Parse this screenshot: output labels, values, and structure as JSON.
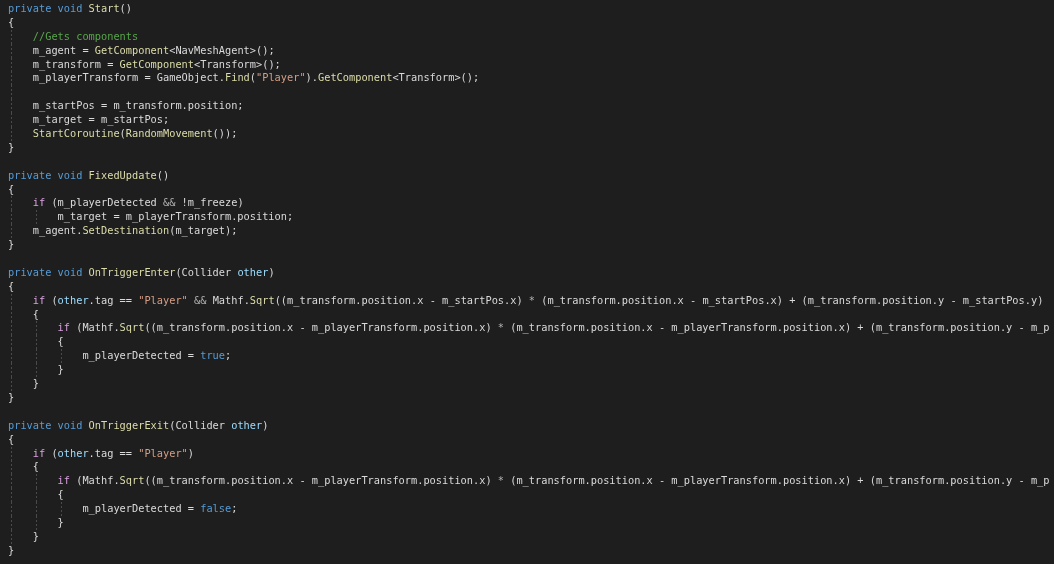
{
  "editor": {
    "lines": [
      {
        "kind": "code",
        "tokens": [
          {
            "text": "private void ",
            "kind": "keyword"
          },
          {
            "text": "Start",
            "kind": "method"
          },
          {
            "text": "()",
            "kind": "plain"
          }
        ]
      },
      {
        "kind": "code",
        "tokens": [
          {
            "text": "{",
            "kind": "plain"
          }
        ]
      },
      {
        "kind": "code",
        "tokens": [
          {
            "text": "    //Gets components",
            "kind": "comment"
          }
        ]
      },
      {
        "kind": "code",
        "tokens": [
          {
            "text": "    m_agent = ",
            "kind": "plain"
          },
          {
            "text": "GetComponent",
            "kind": "method"
          },
          {
            "text": "<NavMeshAgent>();",
            "kind": "plain"
          }
        ]
      },
      {
        "kind": "code",
        "tokens": [
          {
            "text": "    m_transform = ",
            "kind": "plain"
          },
          {
            "text": "GetComponent",
            "kind": "method"
          },
          {
            "text": "<Transform>();",
            "kind": "plain"
          }
        ]
      },
      {
        "kind": "code",
        "tokens": [
          {
            "text": "    m_playerTransform = GameObject.",
            "kind": "plain"
          },
          {
            "text": "Find",
            "kind": "method"
          },
          {
            "text": "(",
            "kind": "plain"
          },
          {
            "text": "\"Player\"",
            "kind": "string"
          },
          {
            "text": ").",
            "kind": "plain"
          },
          {
            "text": "GetComponent",
            "kind": "method"
          },
          {
            "text": "<Transform>();",
            "kind": "plain"
          }
        ]
      },
      {
        "kind": "blank"
      },
      {
        "kind": "code",
        "tokens": [
          {
            "text": "    m_startPos = m_transform.position;",
            "kind": "plain"
          }
        ]
      },
      {
        "kind": "code",
        "tokens": [
          {
            "text": "    m_target = m_startPos;",
            "kind": "plain"
          }
        ]
      },
      {
        "kind": "code",
        "tokens": [
          {
            "text": "    StartCoroutine",
            "kind": "method"
          },
          {
            "text": "(",
            "kind": "plain"
          },
          {
            "text": "RandomMovement",
            "kind": "method"
          },
          {
            "text": "());",
            "kind": "plain"
          }
        ]
      },
      {
        "kind": "code",
        "tokens": [
          {
            "text": "}",
            "kind": "plain"
          }
        ]
      },
      {
        "kind": "blank"
      },
      {
        "kind": "code",
        "tokens": [
          {
            "text": "private void ",
            "kind": "keyword"
          },
          {
            "text": "FixedUpdate",
            "kind": "method"
          },
          {
            "text": "()",
            "kind": "plain"
          }
        ]
      },
      {
        "kind": "code",
        "tokens": [
          {
            "text": "{",
            "kind": "plain"
          }
        ]
      },
      {
        "kind": "code",
        "tokens": [
          {
            "text": "    if",
            "kind": "control"
          },
          {
            "text": " (m_playerDetected ",
            "kind": "plain"
          },
          {
            "text": "&&",
            "kind": "operator"
          },
          {
            "text": " !m_freeze)",
            "kind": "plain"
          }
        ]
      },
      {
        "kind": "code",
        "tokens": [
          {
            "text": "        m_target = m_playerTransform.position;",
            "kind": "plain"
          }
        ]
      },
      {
        "kind": "code",
        "tokens": [
          {
            "text": "    m_agent.",
            "kind": "plain"
          },
          {
            "text": "SetDestination",
            "kind": "method"
          },
          {
            "text": "(m_target);",
            "kind": "plain"
          }
        ]
      },
      {
        "kind": "code",
        "tokens": [
          {
            "text": "}",
            "kind": "plain"
          }
        ]
      },
      {
        "kind": "blank"
      },
      {
        "kind": "code",
        "tokens": [
          {
            "text": "private void ",
            "kind": "keyword"
          },
          {
            "text": "OnTriggerEnter",
            "kind": "method"
          },
          {
            "text": "(Collider ",
            "kind": "plain"
          },
          {
            "text": "other",
            "kind": "param"
          },
          {
            "text": ")",
            "kind": "plain"
          }
        ]
      },
      {
        "kind": "code",
        "tokens": [
          {
            "text": "{",
            "kind": "plain"
          }
        ]
      },
      {
        "kind": "code",
        "tokens": [
          {
            "text": "    if",
            "kind": "control"
          },
          {
            "text": " (",
            "kind": "plain"
          },
          {
            "text": "other",
            "kind": "param"
          },
          {
            "text": ".tag == ",
            "kind": "plain"
          },
          {
            "text": "\"Player\"",
            "kind": "string"
          },
          {
            "text": " &&",
            "kind": "operator"
          },
          {
            "text": " Mathf.",
            "kind": "plain"
          },
          {
            "text": "Sqrt",
            "kind": "method"
          },
          {
            "text": "((m_transform.position.x - m_startPos.x) ",
            "kind": "plain"
          },
          {
            "text": "*",
            "kind": "operator"
          },
          {
            "text": " (m_transform.position.x - m_startPos.x) + (m_transform.position.y - m_startPos.y)",
            "kind": "plain"
          }
        ]
      },
      {
        "kind": "code",
        "tokens": [
          {
            "text": "    {",
            "kind": "plain"
          }
        ]
      },
      {
        "kind": "code",
        "tokens": [
          {
            "text": "        if",
            "kind": "control"
          },
          {
            "text": " (Mathf.",
            "kind": "plain"
          },
          {
            "text": "Sqrt",
            "kind": "method"
          },
          {
            "text": "((m_transform.position.x - m_playerTransform.position.x) ",
            "kind": "plain"
          },
          {
            "text": "*",
            "kind": "operator"
          },
          {
            "text": " (m_transform.position.x - m_playerTransform.position.x) + (m_transform.position.y - m_p",
            "kind": "plain"
          }
        ]
      },
      {
        "kind": "code",
        "tokens": [
          {
            "text": "        {",
            "kind": "plain"
          }
        ]
      },
      {
        "kind": "code",
        "tokens": [
          {
            "text": "            m_playerDetected = ",
            "kind": "plain"
          },
          {
            "text": "true",
            "kind": "keyword"
          },
          {
            "text": ";",
            "kind": "plain"
          }
        ]
      },
      {
        "kind": "code",
        "tokens": [
          {
            "text": "        }",
            "kind": "plain"
          }
        ]
      },
      {
        "kind": "code",
        "tokens": [
          {
            "text": "    }",
            "kind": "plain"
          }
        ]
      },
      {
        "kind": "code",
        "tokens": [
          {
            "text": "}",
            "kind": "plain"
          }
        ]
      },
      {
        "kind": "blank"
      },
      {
        "kind": "code",
        "tokens": [
          {
            "text": "private void ",
            "kind": "keyword"
          },
          {
            "text": "OnTriggerExit",
            "kind": "method"
          },
          {
            "text": "(Collider ",
            "kind": "plain"
          },
          {
            "text": "other",
            "kind": "param"
          },
          {
            "text": ")",
            "kind": "plain"
          }
        ]
      },
      {
        "kind": "code",
        "tokens": [
          {
            "text": "{",
            "kind": "plain"
          }
        ]
      },
      {
        "kind": "code",
        "tokens": [
          {
            "text": "    if",
            "kind": "control"
          },
          {
            "text": " (",
            "kind": "plain"
          },
          {
            "text": "other",
            "kind": "param"
          },
          {
            "text": ".tag == ",
            "kind": "plain"
          },
          {
            "text": "\"Player\"",
            "kind": "string"
          },
          {
            "text": ")",
            "kind": "plain"
          }
        ]
      },
      {
        "kind": "code",
        "tokens": [
          {
            "text": "    {",
            "kind": "plain"
          }
        ]
      },
      {
        "kind": "code",
        "tokens": [
          {
            "text": "        if",
            "kind": "control"
          },
          {
            "text": " (Mathf.",
            "kind": "plain"
          },
          {
            "text": "Sqrt",
            "kind": "method"
          },
          {
            "text": "((m_transform.position.x - m_playerTransform.position.x) ",
            "kind": "plain"
          },
          {
            "text": "*",
            "kind": "operator"
          },
          {
            "text": " (m_transform.position.x - m_playerTransform.position.x) + (m_transform.position.y - m_p",
            "kind": "plain"
          }
        ]
      },
      {
        "kind": "code",
        "tokens": [
          {
            "text": "        {",
            "kind": "plain"
          }
        ]
      },
      {
        "kind": "code",
        "tokens": [
          {
            "text": "            m_playerDetected = ",
            "kind": "plain"
          },
          {
            "text": "false",
            "kind": "keyword"
          },
          {
            "text": ";",
            "kind": "plain"
          }
        ]
      },
      {
        "kind": "code",
        "tokens": [
          {
            "text": "        }",
            "kind": "plain"
          }
        ]
      },
      {
        "kind": "code",
        "tokens": [
          {
            "text": "    }",
            "kind": "plain"
          }
        ]
      },
      {
        "kind": "code",
        "tokens": [
          {
            "text": "}",
            "kind": "plain"
          }
        ]
      }
    ]
  }
}
